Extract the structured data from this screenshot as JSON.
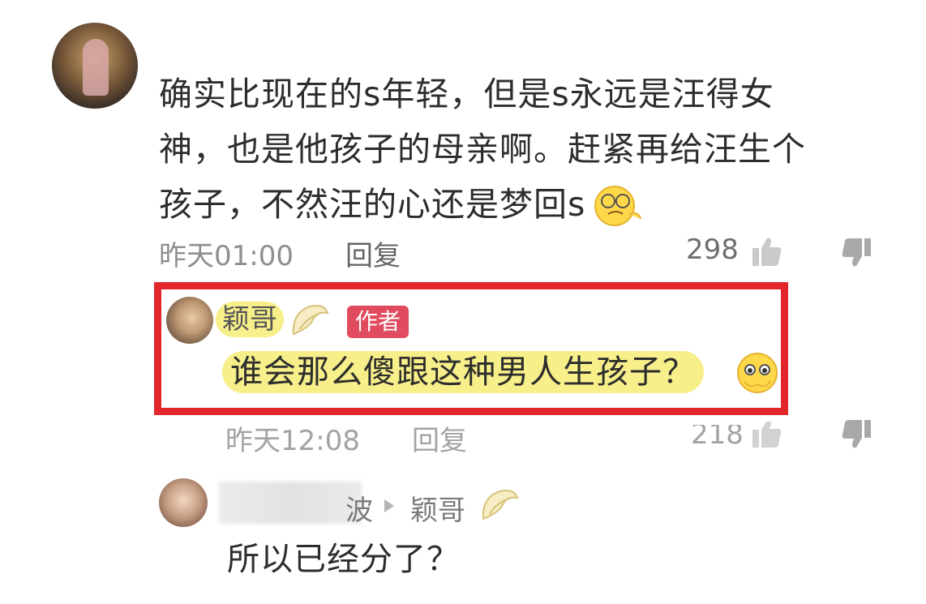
{
  "comment1": {
    "text_line1": "确实比现在的s年轻，但是s永远是汪得女",
    "text_line2": "神，也是他孩子的母亲啊。赶紧再给汪生个",
    "text_line3": "孩子，不然汪的心还是梦回s",
    "emoji": "smug-face-emoji",
    "time": "昨天01:00",
    "reply_label": "回复",
    "likes": "298"
  },
  "reply1": {
    "username": "颖哥",
    "author_tag": "作者",
    "text": "谁会那么傻跟这种男人生孩子？",
    "emoji": "pleading-face-emoji",
    "time": "昨天12:08",
    "reply_label": "回复",
    "likes": "218"
  },
  "reply2": {
    "username_suffix": "波",
    "reply_to": "颖哥",
    "text": "所以已经分了？"
  },
  "colors": {
    "highlight_border": "#e2272c",
    "name_highlight": "#f7ef8a",
    "author_tag": "#e04b5f",
    "meta_text": "#8e8e8e"
  }
}
